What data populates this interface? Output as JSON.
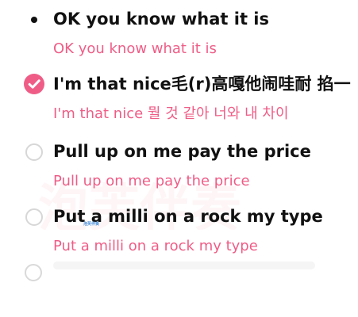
{
  "watermark": {
    "text": "泡芙伴奏"
  },
  "lyrics": [
    {
      "text": "OK you know what it is",
      "translation": "OK you know what it is",
      "state": "current"
    },
    {
      "text": "I'm that nice毛(r)高嘎他闹哇耐 掐一",
      "translation": "I'm that nice 뭘 것 같아 너와 내 차이",
      "state": "selected"
    },
    {
      "text": "Pull up on me pay the price",
      "translation": "Pull up on me pay the price",
      "state": "unselected"
    },
    {
      "text": "Put a milli on a rock my type",
      "translation": "Put a milli on a rock my type",
      "state": "unselected"
    }
  ],
  "small_caption": "泡芙伴奏",
  "colors": {
    "accent_pink": "#ef5d87",
    "primary_text": "#111111",
    "radio_border": "#d7d7d7",
    "caption_blue": "#4a8fd8"
  },
  "icons": {
    "current_line": "bullet-dot-icon",
    "selected_line": "checkmark-circle-icon",
    "unselected_line": "empty-radio-icon"
  }
}
